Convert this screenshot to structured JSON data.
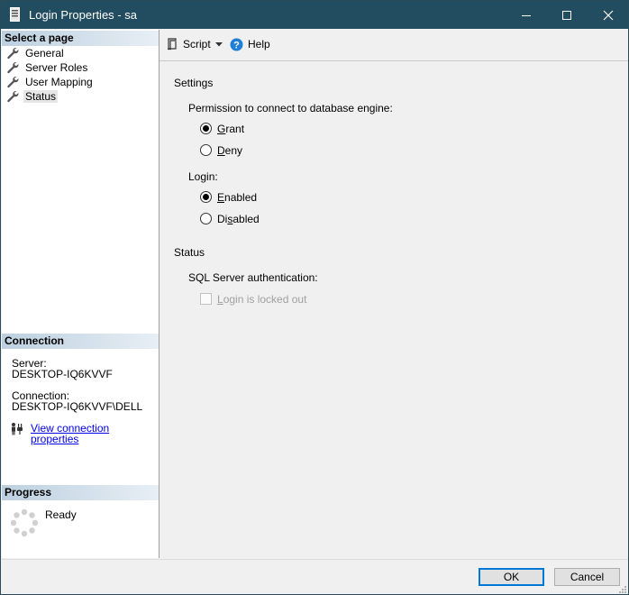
{
  "window": {
    "title": "Login Properties - sa"
  },
  "title_buttons": {
    "minimize": "minimize",
    "maximize": "maximize",
    "close": "close"
  },
  "left": {
    "select_page_header": "Select a page",
    "pages": [
      {
        "label": "General"
      },
      {
        "label": "Server Roles"
      },
      {
        "label": "User Mapping"
      },
      {
        "label": "Status",
        "selected": true
      }
    ],
    "connection_header": "Connection",
    "server_label": "Server:",
    "server_value": "DESKTOP-IQ6KVVF",
    "connection_label": "Connection:",
    "connection_value": "DESKTOP-IQ6KVVF\\DELL",
    "view_connection_link": "View connection properties",
    "progress_header": "Progress",
    "progress_status": "Ready"
  },
  "toolbar": {
    "script_label": "Script",
    "help_label": "Help"
  },
  "main": {
    "settings_header": "Settings",
    "permission_label": "Permission to connect to database engine:",
    "grant_label_first": "G",
    "grant_label_rest": "rant",
    "deny_label_first": "D",
    "deny_label_rest": "eny",
    "login_label": "Login:",
    "enabled_label_first": "E",
    "enabled_label_rest": "nabled",
    "disabled_label_pre": "Di",
    "disabled_label_key": "s",
    "disabled_label_rest": "abled",
    "status_header": "Status",
    "sql_auth_label": "SQL Server authentication:",
    "locked_label_first": "L",
    "locked_label_rest": "ogin is locked out",
    "permission_selected": "Grant",
    "login_selected": "Enabled",
    "locked_out": false
  },
  "buttons": {
    "ok": "OK",
    "cancel": "Cancel"
  },
  "colors": {
    "titlebar": "#224c5f",
    "link": "#0000ee",
    "default_button_border": "#0078d7"
  }
}
